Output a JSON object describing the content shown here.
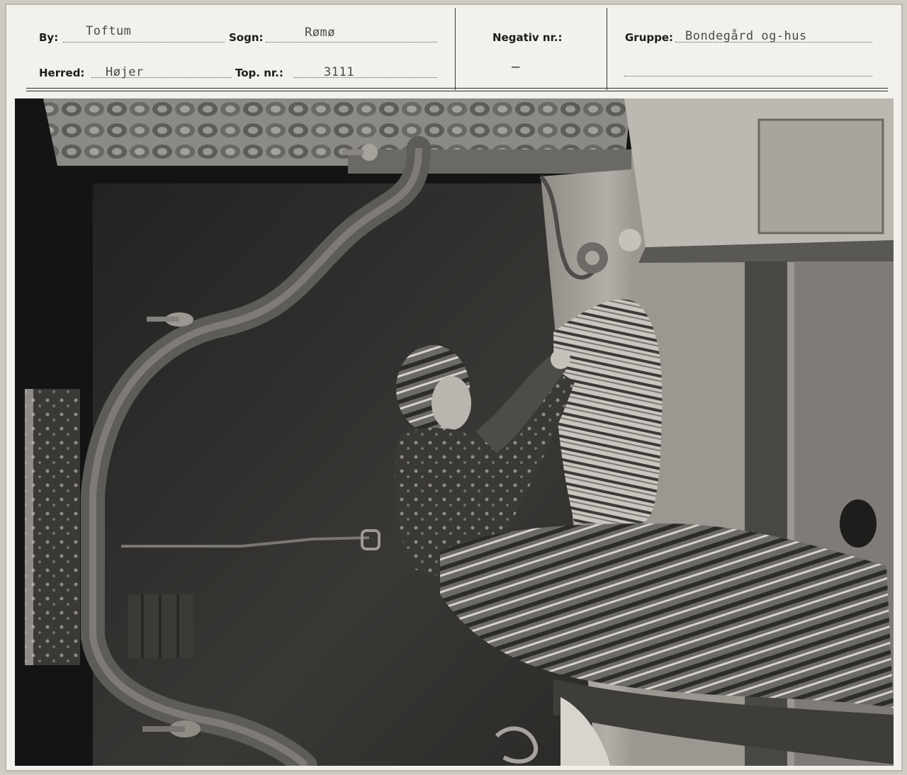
{
  "card": {
    "by": {
      "label": "By:",
      "value": "Toftum"
    },
    "sogn": {
      "label": "Sogn:",
      "value": "Rømø"
    },
    "herred": {
      "label": "Herred:",
      "value": "Højer"
    },
    "top_nr": {
      "label": "Top. nr.:",
      "value": "3111"
    },
    "negativ": {
      "label": "Negativ nr.:",
      "value": "–"
    },
    "gruppe": {
      "label": "Gruppe:",
      "value": "Bondegård og-hus"
    }
  }
}
